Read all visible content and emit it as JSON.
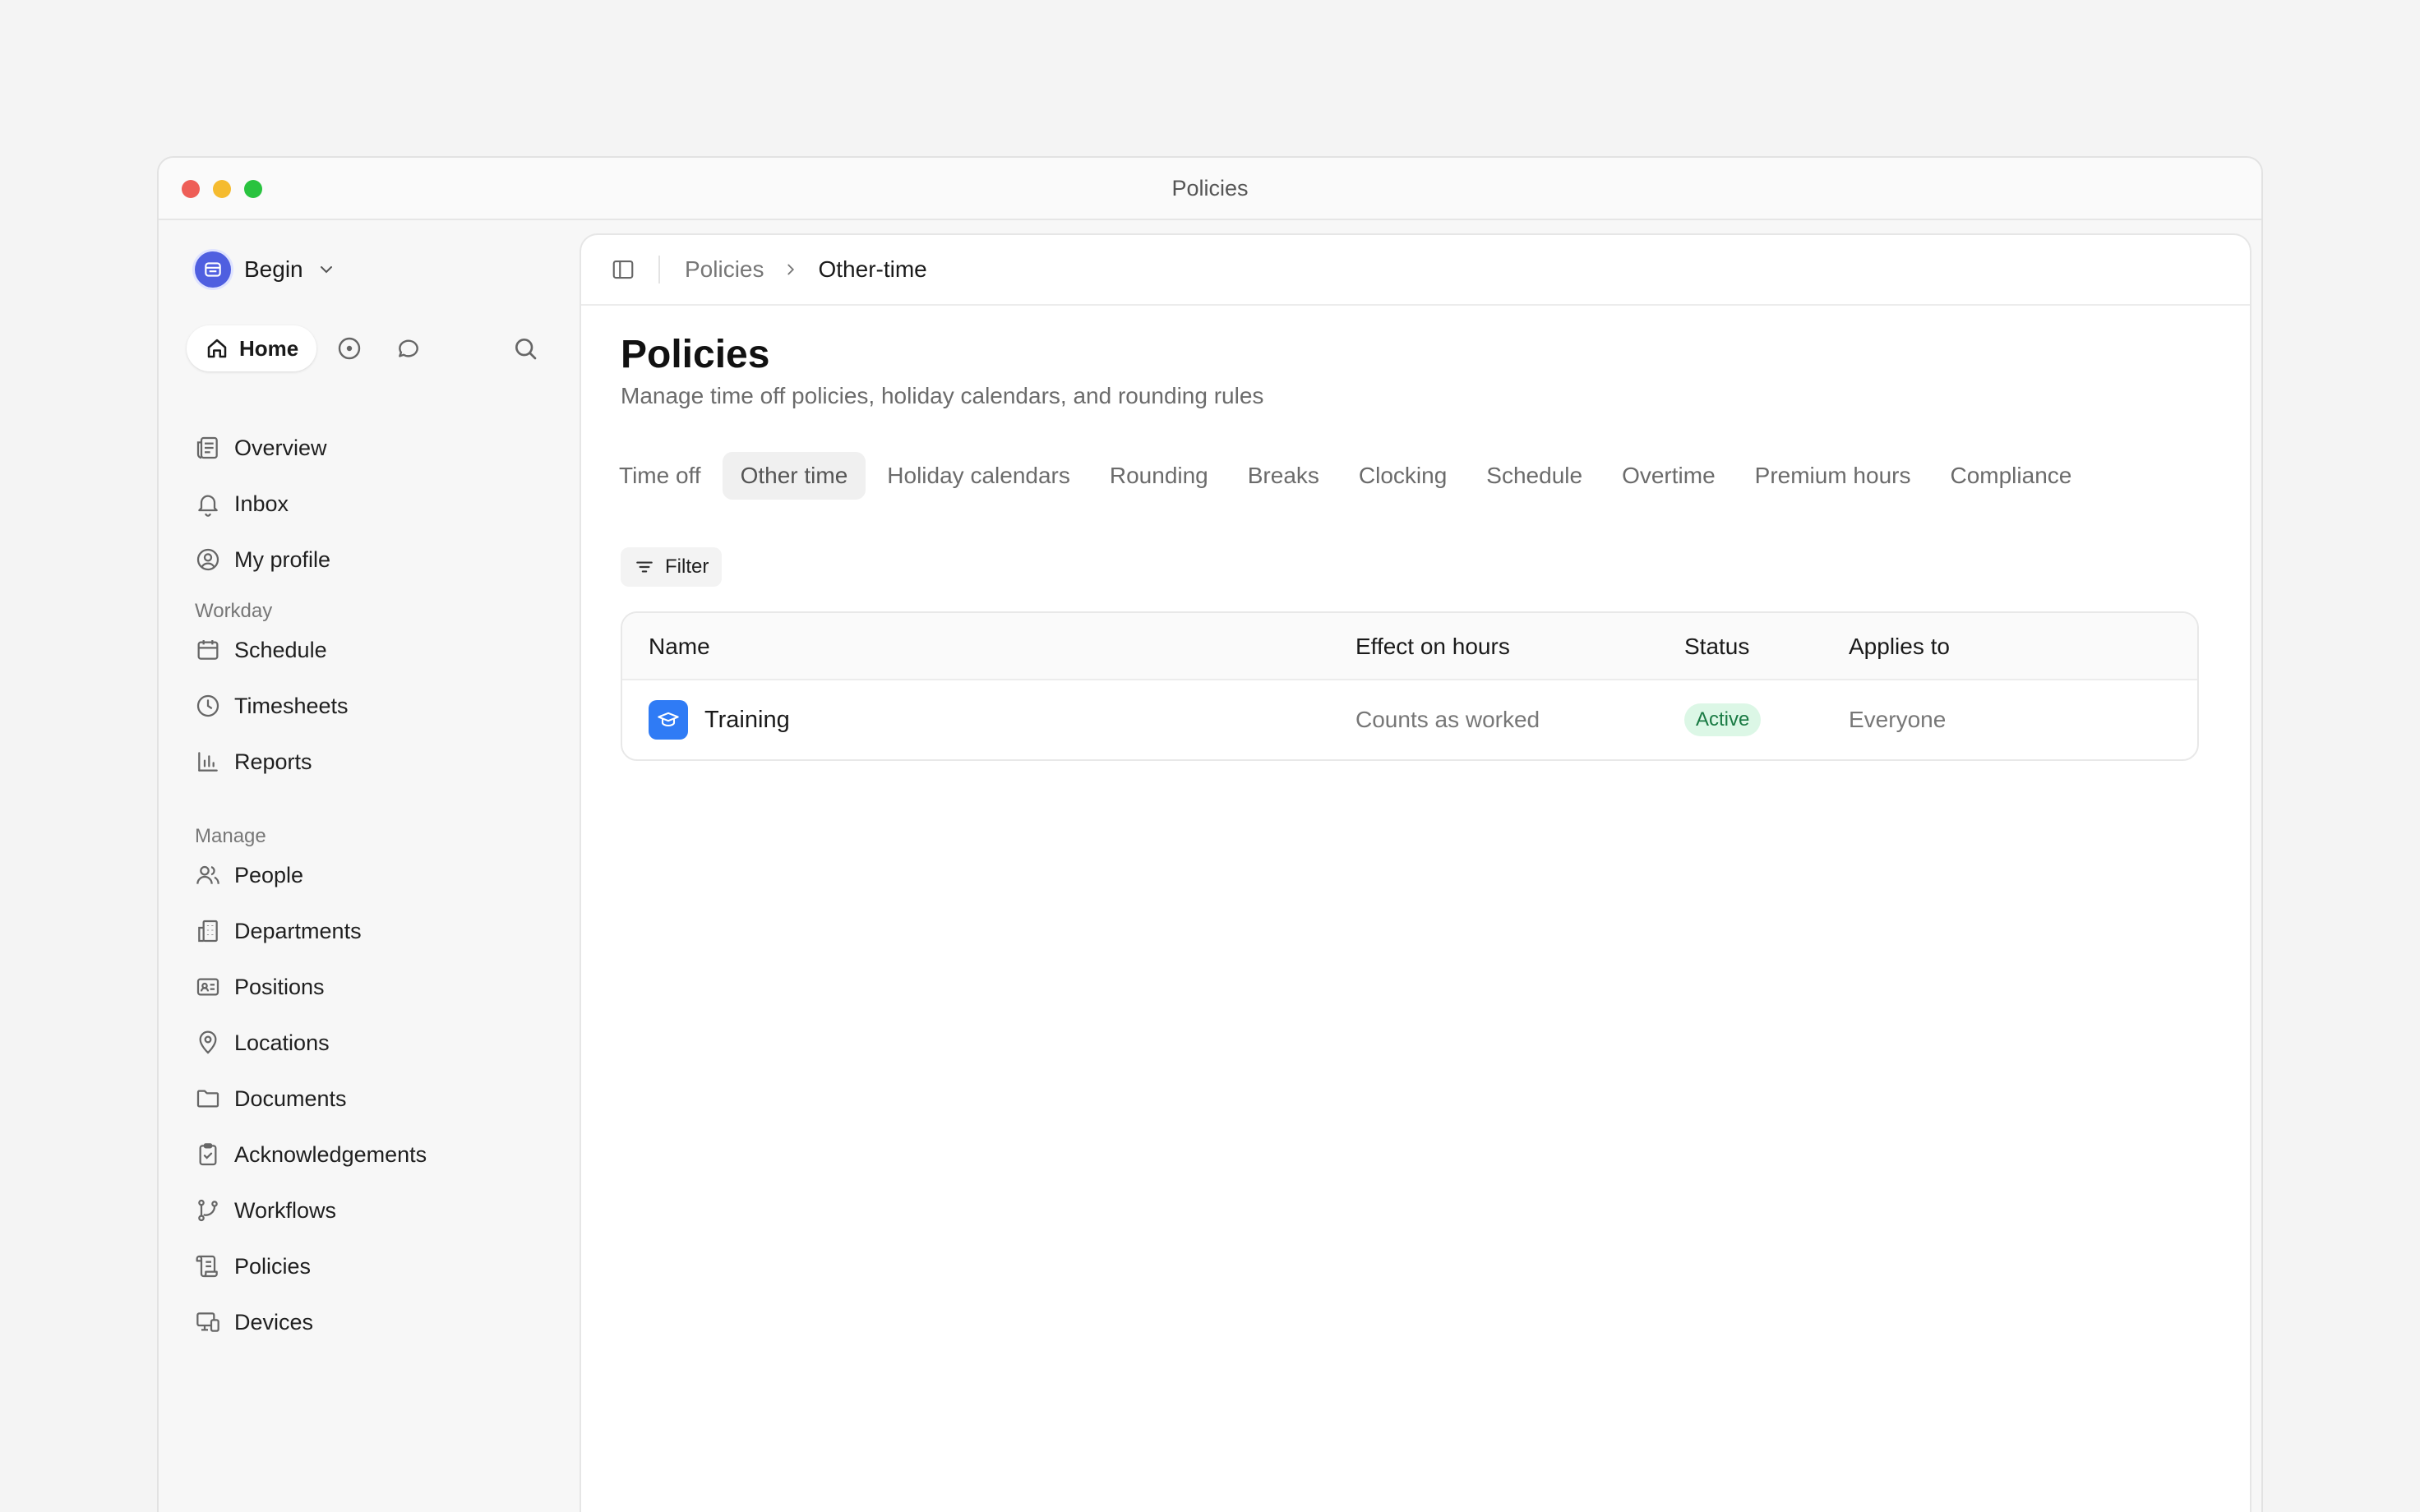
{
  "window": {
    "title": "Policies"
  },
  "sidebar": {
    "workspace": "Begin",
    "home_label": "Home",
    "top_items": [
      {
        "label": "Overview",
        "icon": "newspaper-icon"
      },
      {
        "label": "Inbox",
        "icon": "bell-icon"
      },
      {
        "label": "My profile",
        "icon": "user-circle-icon"
      }
    ],
    "sections": [
      {
        "label": "Workday",
        "items": [
          {
            "label": "Schedule",
            "icon": "calendar-icon"
          },
          {
            "label": "Timesheets",
            "icon": "clock-icon"
          },
          {
            "label": "Reports",
            "icon": "bar-chart-icon"
          }
        ]
      },
      {
        "label": "Manage",
        "items": [
          {
            "label": "People",
            "icon": "users-icon"
          },
          {
            "label": "Departments",
            "icon": "building-icon"
          },
          {
            "label": "Positions",
            "icon": "id-card-icon"
          },
          {
            "label": "Locations",
            "icon": "map-pin-icon"
          },
          {
            "label": "Documents",
            "icon": "folder-icon"
          },
          {
            "label": "Acknowledgements",
            "icon": "clipboard-check-icon"
          },
          {
            "label": "Workflows",
            "icon": "git-branch-icon"
          },
          {
            "label": "Policies",
            "icon": "scroll-icon"
          },
          {
            "label": "Devices",
            "icon": "devices-icon"
          }
        ]
      }
    ]
  },
  "breadcrumb": {
    "parent": "Policies",
    "current": "Other-time"
  },
  "page": {
    "title": "Policies",
    "subtitle": "Manage time off policies, holiday calendars, and rounding rules"
  },
  "tabs": [
    {
      "label": "Time off",
      "active": false
    },
    {
      "label": "Other time",
      "active": true
    },
    {
      "label": "Holiday calendars",
      "active": false
    },
    {
      "label": "Rounding",
      "active": false
    },
    {
      "label": "Breaks",
      "active": false
    },
    {
      "label": "Clocking",
      "active": false
    },
    {
      "label": "Schedule",
      "active": false
    },
    {
      "label": "Overtime",
      "active": false
    },
    {
      "label": "Premium hours",
      "active": false
    },
    {
      "label": "Compliance",
      "active": false
    }
  ],
  "filter_label": "Filter",
  "table": {
    "columns": [
      "Name",
      "Effect on hours",
      "Status",
      "Applies to"
    ],
    "rows": [
      {
        "name": "Training",
        "icon": "graduation-cap-icon",
        "effect": "Counts as worked",
        "status": "Active",
        "applies_to": "Everyone"
      }
    ]
  },
  "colors": {
    "accent": "#4f5fe0",
    "row_icon": "#2f7bf5",
    "status_active_bg": "#dcf7e6",
    "status_active_text": "#197a43"
  }
}
